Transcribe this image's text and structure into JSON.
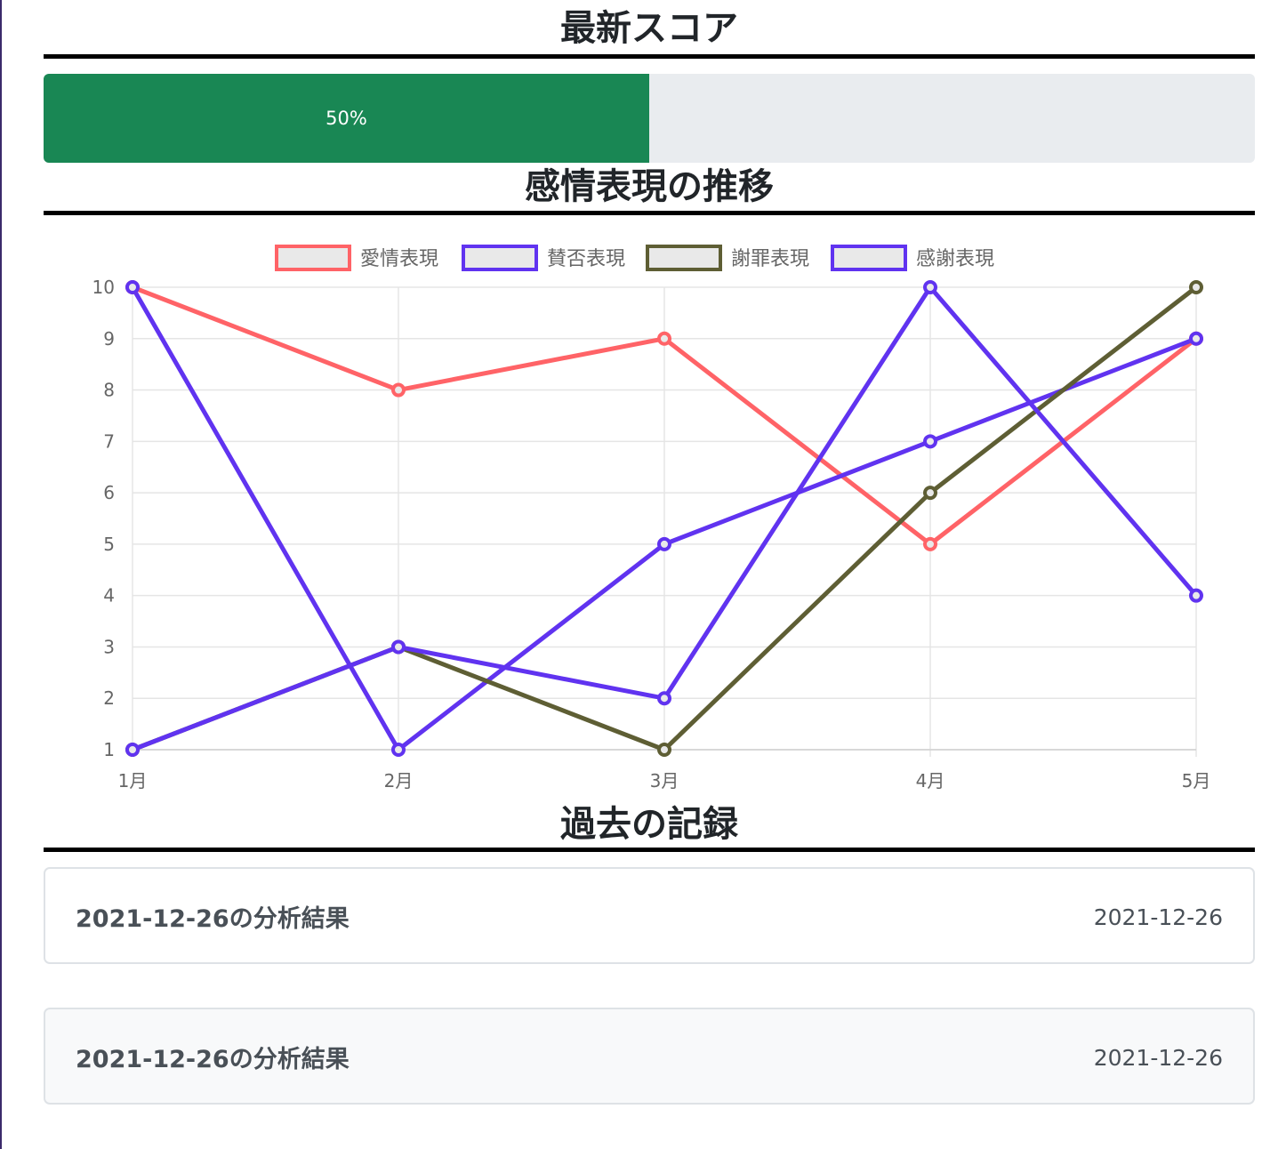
{
  "sections": {
    "latest_score_title": "最新スコア",
    "trend_title": "感情表現の推移",
    "history_title": "過去の記録"
  },
  "progress": {
    "value": 50,
    "label": "50%",
    "color": "#198754",
    "track_color": "#e9ecef"
  },
  "chart_data": {
    "type": "line",
    "categories": [
      "1月",
      "2月",
      "3月",
      "4月",
      "5月"
    ],
    "ylim": [
      1,
      10
    ],
    "yticks": [
      1,
      2,
      3,
      4,
      5,
      6,
      7,
      8,
      9,
      10
    ],
    "grid": true,
    "legend_position": "top",
    "series": [
      {
        "name": "愛情表現",
        "color": "#ff6367",
        "values": [
          10,
          8,
          9,
          5,
          9
        ]
      },
      {
        "name": "賛否表現",
        "color": "#6033f0",
        "values": [
          10,
          1,
          5,
          7,
          9
        ]
      },
      {
        "name": "謝罪表現",
        "color": "#5e5e34",
        "values": [
          1,
          3,
          1,
          6,
          10
        ]
      },
      {
        "name": "感謝表現",
        "color": "#6033f0",
        "values": [
          1,
          3,
          2,
          10,
          4
        ]
      }
    ]
  },
  "records": [
    {
      "title": "2021-12-26の分析結果",
      "date": "2021-12-26"
    },
    {
      "title": "2021-12-26の分析結果",
      "date": "2021-12-26"
    }
  ]
}
